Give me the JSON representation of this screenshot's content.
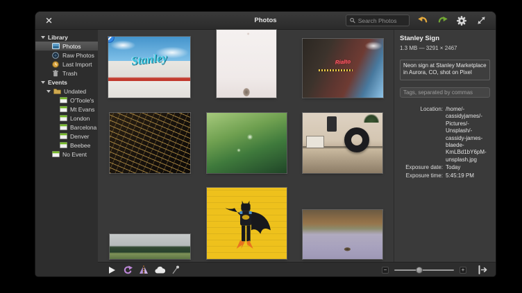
{
  "titlebar": {
    "title": "Photos",
    "search_placeholder": "Search Photos"
  },
  "sidebar": {
    "library_header": "Library",
    "library_items": [
      {
        "label": "Photos",
        "icon": "photos-icon",
        "selected": true
      },
      {
        "label": "Raw Photos",
        "icon": "raw-photos-icon"
      },
      {
        "label": "Last Import",
        "icon": "last-import-icon"
      },
      {
        "label": "Trash",
        "icon": "trash-icon"
      }
    ],
    "events_header": "Events",
    "undated_label": "Undated",
    "undated_events": [
      "O'Toole's",
      "Mt Evans",
      "London",
      "Barcelona",
      "Denver",
      "Beebee"
    ],
    "no_event_label": "No Event"
  },
  "photos": [
    {
      "name": "Stanley sign",
      "overlay": "Stanley",
      "selected": true
    },
    {
      "name": "Cat"
    },
    {
      "name": "Rialto theater",
      "overlay": "Rialto"
    },
    {
      "name": "Circuit board"
    },
    {
      "name": "Plant droplets"
    },
    {
      "name": "Smartwatch"
    },
    {
      "name": "Mountain panorama"
    },
    {
      "name": "Lego Batman"
    },
    {
      "name": "Duck pond"
    }
  ],
  "info_panel": {
    "title": "Stanley Sign",
    "meta": "1.3 MB — 3291 × 2467",
    "description": "Neon sign at Stanley Marketplace in Aurora, CO, shot on Pixel",
    "tags_placeholder": "Tags, separated by commas",
    "location_label": "Location:",
    "location_value": "/home/-\ncassidyjames/-\nPictures/-\nUnsplash/-\ncassidy-james-\nblaede-\nKmLBd1bY6pM-\nunsplash.jpg",
    "exposure_date_label": "Exposure date:",
    "exposure_date_value": "Today",
    "exposure_time_label": "Exposure time:",
    "exposure_time_value": "5:45:19 PM"
  },
  "toolbar": {
    "zoom_out_glyph": "−",
    "zoom_in_glyph": "+"
  },
  "colors": {
    "accent_blue": "#3689e6",
    "undo_orange": "#e3a93d",
    "redo_green": "#72a834",
    "rotate_purple": "#bd87d8",
    "event_green": "#76b82a"
  }
}
